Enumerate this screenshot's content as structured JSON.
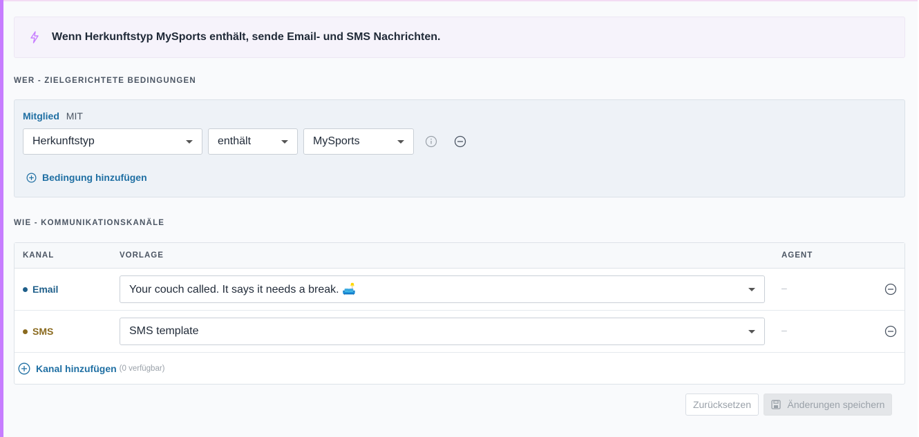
{
  "summary": {
    "text": "Wenn Herkunftstyp MySports enthält, sende Email- und SMS Nachrichten."
  },
  "who": {
    "title": "WER - ZIELGERICHTETE BEDINGUNGEN",
    "entity": "Mitglied",
    "operator": "MIT",
    "condition": {
      "field": "Herkunftstyp",
      "comparator": "enthält",
      "value": "MySports"
    },
    "add_label": "Bedingung hinzufügen"
  },
  "how": {
    "title": "WIE - KOMMUNIKATIONSKANÄLE",
    "columns": {
      "channel": "KANAL",
      "template": "VORLAGE",
      "agent": "AGENT"
    },
    "rows": [
      {
        "channel": "Email",
        "color": "#1f5f8a",
        "template": "Your couch called. It says it needs a break. 🛋️",
        "agent": "–"
      },
      {
        "channel": "SMS",
        "color": "#8a6a1f",
        "template": "SMS template",
        "agent": "–"
      }
    ],
    "add_label": "Kanal hinzufügen",
    "available_note": "(0 verfügbar)"
  },
  "footer": {
    "reset_label": "Zurücksetzen",
    "save_label": "Änderungen speichern"
  },
  "colors": {
    "accent": "#c77dff",
    "link": "#1f6fa3"
  }
}
